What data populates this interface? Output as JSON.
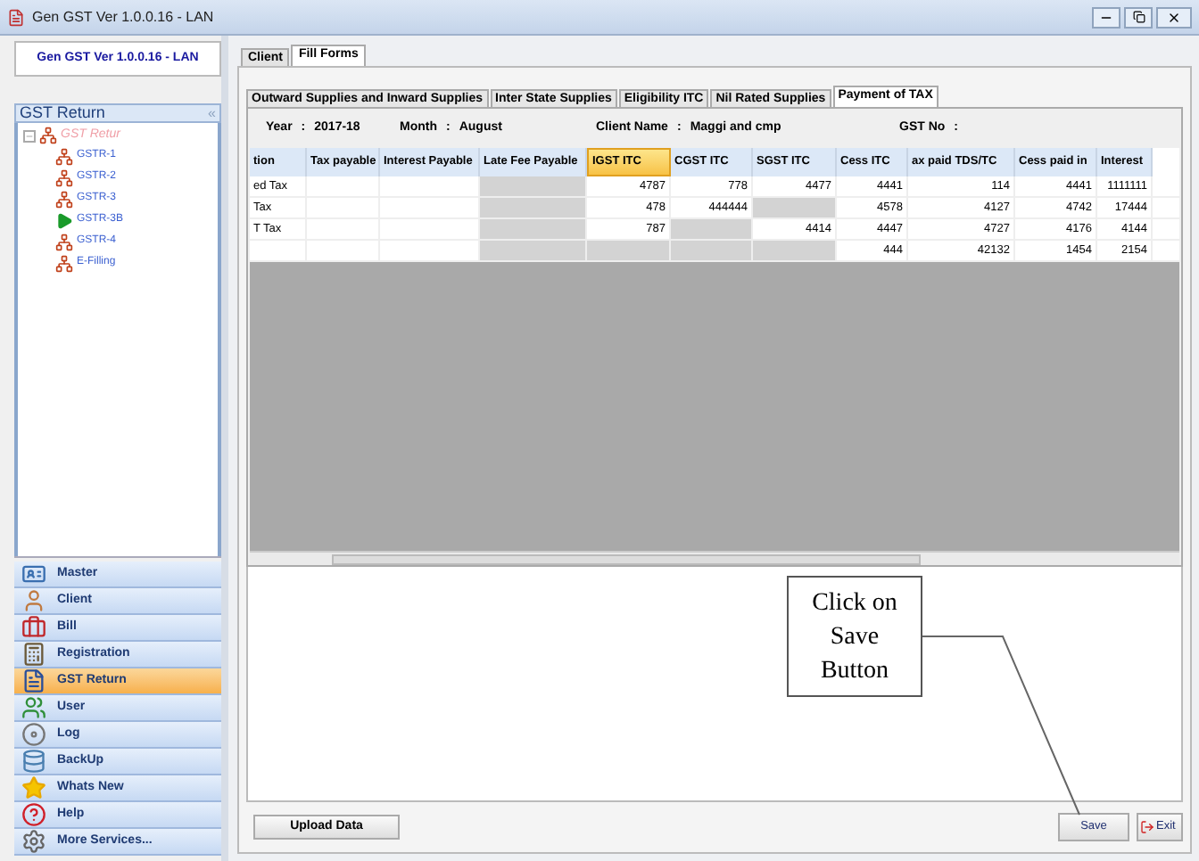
{
  "window": {
    "title": "Gen GST  Ver 1.0.0.16 - LAN"
  },
  "sidebar": {
    "app_label": "Gen GST  Ver 1.0.0.16 - LAN",
    "panel_title": "GST Return",
    "collapse_glyph": "«",
    "tree": {
      "label": "GST Retur",
      "expanded": true,
      "children": [
        {
          "label": "GSTR-1",
          "kind": "org"
        },
        {
          "label": "GSTR-2",
          "kind": "org"
        },
        {
          "label": "GSTR-3",
          "kind": "org"
        },
        {
          "label": "GSTR-3B",
          "kind": "arrow"
        },
        {
          "label": "GSTR-4",
          "kind": "org"
        },
        {
          "label": "E-Filling",
          "kind": "org"
        }
      ]
    },
    "nav": [
      {
        "label": "Master",
        "kind": "card",
        "selected": false
      },
      {
        "label": "Client",
        "kind": "person",
        "selected": false
      },
      {
        "label": "Bill",
        "kind": "bag",
        "selected": false
      },
      {
        "label": "Registration",
        "kind": "calc",
        "selected": false
      },
      {
        "label": "GST Return",
        "kind": "gst",
        "selected": true
      },
      {
        "label": "User",
        "kind": "users",
        "selected": false
      },
      {
        "label": "Log",
        "kind": "disc",
        "selected": false
      },
      {
        "label": "BackUp",
        "kind": "backup",
        "selected": false
      },
      {
        "label": "Whats New",
        "kind": "new",
        "selected": false
      },
      {
        "label": "Help",
        "kind": "help",
        "selected": false
      },
      {
        "label": "More Services...",
        "kind": "gear",
        "selected": false
      }
    ]
  },
  "tabs": [
    {
      "label": "Client",
      "selected": false
    },
    {
      "label": "Fill Forms",
      "selected": true
    }
  ],
  "subtabs": [
    {
      "label": "Outward Supplies and Inward Supplies",
      "selected": false
    },
    {
      "label": "Inter State Supplies",
      "selected": false
    },
    {
      "label": "Eligibility ITC",
      "selected": false
    },
    {
      "label": "Nil Rated Supplies",
      "selected": false
    },
    {
      "label": "Payment of TAX",
      "selected": true
    }
  ],
  "info": [
    {
      "label": "Year",
      "separator": ":",
      "value": "2017-18"
    },
    {
      "label": "Month",
      "separator": ":",
      "value": "August"
    },
    {
      "label": "Client Name",
      "separator": ":",
      "value": "Maggi and cmp"
    },
    {
      "label": "GST No",
      "separator": ":"
    }
  ],
  "table": {
    "columns": [
      {
        "label": "tion",
        "selected": false
      },
      {
        "label": "Tax payable",
        "selected": false
      },
      {
        "label": "Interest Payable",
        "selected": false
      },
      {
        "label": "Late Fee Payable",
        "selected": false
      },
      {
        "label": "IGST ITC",
        "selected": true
      },
      {
        "label": "CGST ITC",
        "selected": false
      },
      {
        "label": "SGST ITC",
        "selected": false
      },
      {
        "label": "Cess ITC",
        "selected": false
      },
      {
        "label": "ax paid TDS/TC",
        "selected": false
      },
      {
        "label": "Cess paid in",
        "selected": false
      },
      {
        "label": "Interest",
        "selected": false
      }
    ],
    "rows": [
      [
        {
          "text": "ed Tax",
          "disabled": false
        },
        {
          "disabled": false
        },
        {
          "disabled": false
        },
        {
          "disabled": true
        },
        {
          "text": "4787",
          "disabled": false
        },
        {
          "text": "778",
          "disabled": false
        },
        {
          "text": "4477",
          "disabled": false
        },
        {
          "text": "4441",
          "disabled": false
        },
        {
          "text": "114",
          "disabled": false
        },
        {
          "text": "4441",
          "disabled": false
        },
        {
          "text": "1111111",
          "disabled": false
        }
      ],
      [
        {
          "text": "Tax",
          "disabled": false
        },
        {
          "disabled": false
        },
        {
          "disabled": false
        },
        {
          "disabled": true
        },
        {
          "text": "478",
          "disabled": false
        },
        {
          "text": "444444",
          "disabled": false
        },
        {
          "disabled": true
        },
        {
          "text": "4578",
          "disabled": false
        },
        {
          "text": "4127",
          "disabled": false
        },
        {
          "text": "4742",
          "disabled": false
        },
        {
          "text": "17444",
          "disabled": false
        }
      ],
      [
        {
          "text": "T Tax",
          "disabled": false
        },
        {
          "disabled": false
        },
        {
          "disabled": false
        },
        {
          "disabled": true
        },
        {
          "text": "787",
          "disabled": false
        },
        {
          "disabled": true
        },
        {
          "text": "4414",
          "disabled": false
        },
        {
          "text": "4447",
          "disabled": false
        },
        {
          "text": "4727",
          "disabled": false
        },
        {
          "text": "4176",
          "disabled": false
        },
        {
          "text": "4144",
          "disabled": false
        }
      ],
      [
        {
          "disabled": false
        },
        {
          "disabled": false
        },
        {
          "disabled": false
        },
        {
          "disabled": true
        },
        {
          "disabled": true
        },
        {
          "disabled": true
        },
        {
          "disabled": true
        },
        {
          "text": "444",
          "disabled": false
        },
        {
          "text": "42132",
          "disabled": false
        },
        {
          "text": "1454",
          "disabled": false
        },
        {
          "text": "2154",
          "disabled": false
        }
      ]
    ]
  },
  "buttons": {
    "upload": "Upload Data",
    "save": "Save",
    "exit": "Exit"
  },
  "callout": "Click on Save Button"
}
